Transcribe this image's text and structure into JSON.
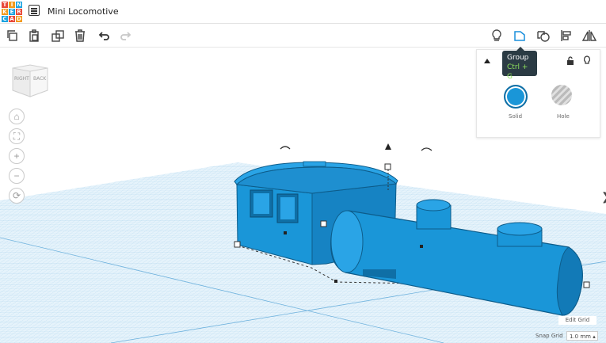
{
  "app": {
    "logo_letters": [
      "T",
      "I",
      "N",
      "K",
      "E",
      "R",
      "C",
      "A",
      "D"
    ],
    "logo_colors": [
      "#e94a3b",
      "#f39a1d",
      "#1aa3e0",
      "#f39a1d",
      "#1aa3e0",
      "#e94a3b",
      "#1aa3e0",
      "#e94a3b",
      "#f39a1d"
    ],
    "title": "Mini Locomotive"
  },
  "toolbar": {
    "left_icons": [
      "copy-icon",
      "paste-icon",
      "duplicate-icon",
      "delete-icon",
      "undo-icon",
      "redo-icon"
    ],
    "right_icons": [
      "lightbulb-icon",
      "group-icon",
      "ungroup-icon",
      "align-icon",
      "mirror-icon"
    ],
    "active": "group-icon"
  },
  "tooltip": {
    "title": "Group",
    "shortcut": "Ctrl + G"
  },
  "inspector": {
    "solid_label": "Solid",
    "hole_label": "Hole",
    "solid_color": "#1a96d8"
  },
  "viewcube": {
    "left_face": "RIGHT",
    "right_face": "BACK"
  },
  "nav": [
    "home-icon",
    "fit-view-icon",
    "zoom-in-icon",
    "zoom-out-icon",
    "orbit-icon"
  ],
  "footer": {
    "edit_grid": "Edit Grid",
    "snap_label": "Snap Grid",
    "snap_value": "1.0 mm ▴"
  },
  "colors": {
    "shape": "#1a96d8",
    "shape_dark": "#0f6fa6",
    "grid": "#cfe6f5",
    "accent": "#1a8fdc"
  }
}
